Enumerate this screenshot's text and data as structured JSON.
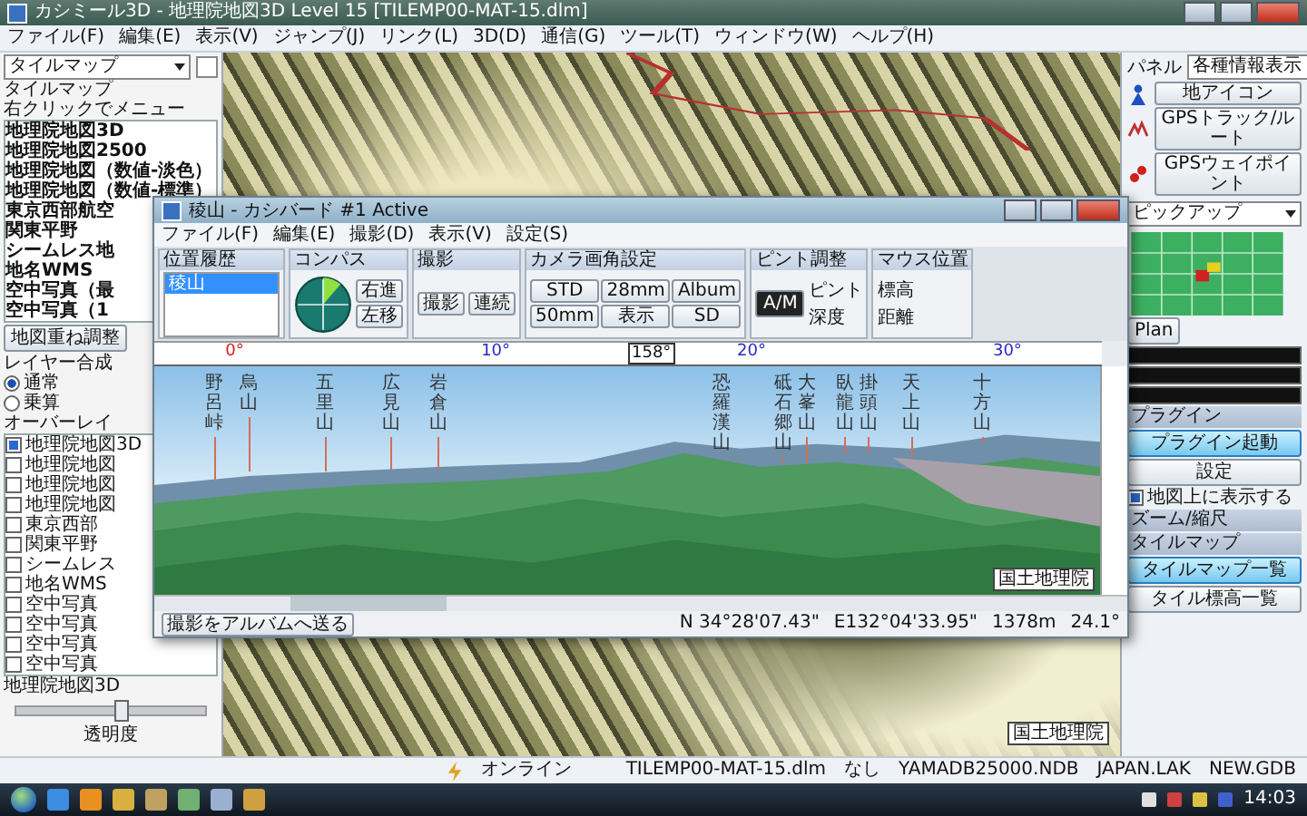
{
  "window": {
    "title": "カシミール3D - 地理院地図3D Level 15 [TILEMP00-MAT-15.dlm]"
  },
  "menu": [
    "ファイル(F)",
    "編集(E)",
    "表示(V)",
    "ジャンプ(J)",
    "リンク(L)",
    "3D(D)",
    "通信(G)",
    "ツール(T)",
    "ウィンドウ(W)",
    "ヘルプ(H)"
  ],
  "left_panel": {
    "selector": "タイルマップ",
    "header": "タイルマップ",
    "hint": "右クリックでメニュー",
    "items": [
      "地理院地図3D",
      "地理院地図2500",
      "地理院地図（数値-淡色）",
      "地理院地図（数値-標準）",
      "東京西部航空",
      "関東平野",
      "シームレス地",
      "地名WMS",
      "空中写真（最",
      "空中写真（1"
    ],
    "adjust_button": "地図重ね調整",
    "blend": {
      "label": "レイヤー合成",
      "options": [
        {
          "label": "通常",
          "selected": true
        },
        {
          "label": "乗算",
          "selected": false
        }
      ]
    },
    "overlay_label": "オーバーレイ",
    "overlays": [
      {
        "label": "地理院地図3D",
        "checked": true
      },
      {
        "label": "地理院地図",
        "checked": false
      },
      {
        "label": "地理院地図",
        "checked": false
      },
      {
        "label": "地理院地図",
        "checked": false
      },
      {
        "label": "東京西部",
        "checked": false
      },
      {
        "label": "関東平野",
        "checked": false
      },
      {
        "label": "シームレス",
        "checked": false
      },
      {
        "label": "地名WMS",
        "checked": false
      },
      {
        "label": "空中写真",
        "checked": false
      },
      {
        "label": "空中写真",
        "checked": false
      },
      {
        "label": "空中写真",
        "checked": false
      },
      {
        "label": "空中写真",
        "checked": false
      }
    ],
    "layer_name": "地理院地図3D",
    "opacity": {
      "label": "透明度",
      "level": 0.55
    }
  },
  "map": {
    "attribution": "国土地理院"
  },
  "right_panel": {
    "label": "パネル",
    "selector": "各種情報表示",
    "buttons": [
      "地アイコン",
      "GPSトラック/ルート",
      "GPSウェイポイント"
    ],
    "pickup": "ピックアップ",
    "plan": "Plan",
    "plugin_header": "プラグイン",
    "plugin_buttons": [
      {
        "label": "プラグイン起動",
        "selected": true
      },
      {
        "label": "設定",
        "selected": false
      }
    ],
    "show_on_map": {
      "label": "地図上に表示する",
      "checked": true
    },
    "zoom_header": "ズーム/縮尺",
    "tile_header": "タイルマップ",
    "tile_buttons": [
      {
        "label": "タイルマップ一覧",
        "selected": true
      },
      {
        "label": "タイル標高一覧",
        "selected": false
      }
    ]
  },
  "viewer": {
    "title": "稜山 - カシバード #1 Active",
    "menu": [
      "ファイル(F)",
      "編集(E)",
      "撮影(D)",
      "表示(V)",
      "設定(S)"
    ],
    "history": {
      "title": "位置履歴",
      "items": [
        {
          "label": "稜山",
          "selected": true
        }
      ]
    },
    "compass": {
      "title": "コンパス",
      "buttons": [
        "右進",
        "左移"
      ]
    },
    "shoot": {
      "title": "撮影",
      "buttons": [
        "撮影",
        "連続"
      ]
    },
    "camera": {
      "title": "カメラ画角設定",
      "buttons": [
        "STD",
        "28mm",
        "Album",
        "50mm",
        "表示",
        "SD"
      ]
    },
    "focus": {
      "title": "ピント調整",
      "mode": "A/M",
      "labels": [
        "ピント",
        "深度"
      ]
    },
    "mouse": {
      "title": "マウス位置",
      "labels": [
        "標高",
        "距離"
      ]
    },
    "ruler": [
      {
        "label": "0°",
        "color": "#d02020"
      },
      {
        "label": "10°",
        "color": "#2828c8"
      },
      {
        "label": "20°",
        "color": "#2828c8"
      },
      {
        "label": "30°",
        "color": "#2828c8"
      }
    ],
    "heading": "158°",
    "peaks": [
      "野呂峠",
      "烏山",
      "五里山",
      "広見山",
      "岩倉山",
      "恐羅漢山",
      "砥石郷山",
      "大峯山",
      "臥龍山",
      "掛頭山",
      "天上山",
      "十方山"
    ],
    "attribution": "国土地理院",
    "album_button": "撮影をアルバムへ送る",
    "position": [
      "N 34°28'07.43\"",
      "E132°04'33.95\"",
      "1378m",
      "24.1°"
    ]
  },
  "status_bar": {
    "online": "オンライン",
    "fields": [
      "TILEMP00-MAT-15.dlm",
      "なし",
      "YAMADB25000.NDB",
      "JAPAN.LAK",
      "NEW.GDB"
    ]
  },
  "taskbar": {
    "clock": "14:03"
  }
}
